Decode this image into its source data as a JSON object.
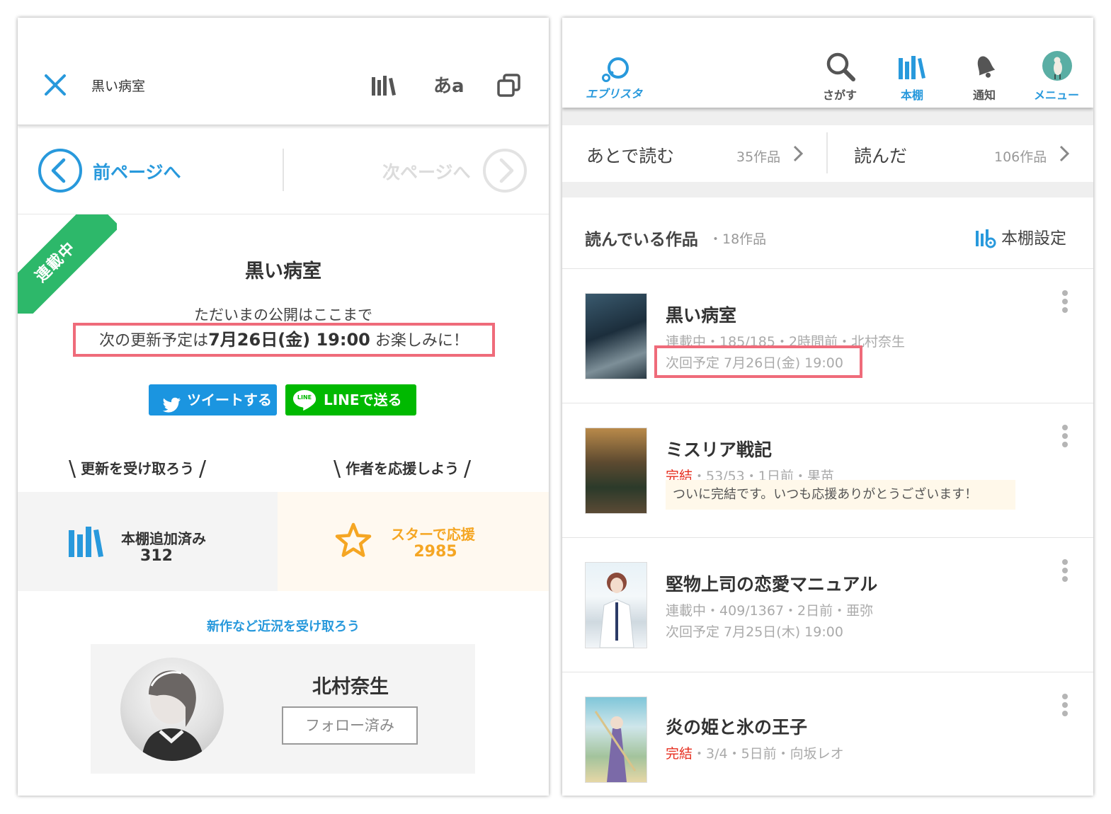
{
  "left": {
    "header": {
      "close_icon": "close-icon",
      "title": "黒い病室",
      "icons": [
        "bookshelf-icon",
        "font-size-icon",
        "copy-icon"
      ],
      "font_label": "あa"
    },
    "pager": {
      "prev": "前ページへ",
      "next": "次ページへ"
    },
    "ribbon": "連載中",
    "work_title": "黒い病室",
    "publication_line": "ただいまの公開はここまで",
    "next_update": {
      "prefix": "次の更新予定は",
      "datetime": "7月26日(金) 19:00",
      "suffix": "お楽しみに！"
    },
    "share": {
      "tweet": "ツイートする",
      "line": "LINEで送る",
      "line_logo": "LINE"
    },
    "receive_updates": "更新を受け取ろう",
    "support_author": "作者を応援しよう",
    "bookshelf_stat": {
      "label": "本棚追加済み",
      "count": "312"
    },
    "star_stat": {
      "label": "スターで応援",
      "count": "2985"
    },
    "news_link": "新作など近況を受け取ろう",
    "author": {
      "name": "北村奈生",
      "follow_label": "フォロー済み"
    },
    "colors": {
      "accent": "#2899dc",
      "ribbon": "#2db86a",
      "star": "#f5a623",
      "highlight": "#ef6b7a",
      "line_green": "#00b900"
    }
  },
  "right": {
    "nav": [
      {
        "label": "エブリスタ",
        "icon": "estar-logo-icon",
        "active": true
      },
      {
        "label": "さがす",
        "icon": "search-icon",
        "active": false
      },
      {
        "label": "本棚",
        "icon": "bookshelf-icon",
        "active": true
      },
      {
        "label": "通知",
        "icon": "bell-icon",
        "active": false
      },
      {
        "label": "メニュー",
        "icon": "avatar-icon",
        "active": true
      }
    ],
    "read_later": {
      "label": "あとで読む",
      "count": "35作品"
    },
    "read_done": {
      "label": "読んだ",
      "count": "106作品"
    },
    "reading": {
      "label": "読んでいる作品",
      "count": "・18作品",
      "settings": "本棚設定"
    },
    "items": [
      {
        "title": "黒い病室",
        "status": "連載中",
        "meta": "・185/185・2時間前・北村奈生",
        "next": "次回予定 7月26日(金) 19:00",
        "note": ""
      },
      {
        "title": "ミスリア戦記",
        "status": "完結",
        "meta": "・53/53・1日前・果苗",
        "next": "",
        "note": "ついに完結です。いつも応援ありがとうございます！"
      },
      {
        "title": "堅物上司の恋愛マニュアル",
        "status": "連載中",
        "meta": "・409/1367・2日前・亜弥",
        "next": "次回予定 7月25日(木) 19:00",
        "note": ""
      },
      {
        "title": "炎の姫と氷の王子",
        "status": "完結",
        "meta": "・3/4・5日前・向坂レオ",
        "next": "",
        "note": ""
      }
    ]
  }
}
